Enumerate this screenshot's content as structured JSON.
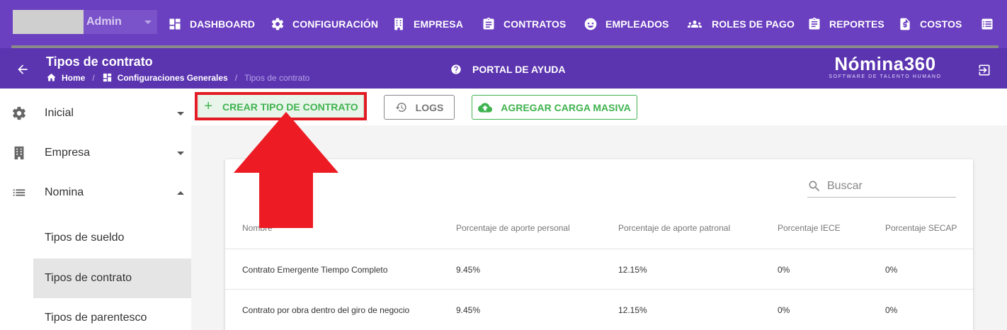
{
  "user": {
    "name": "Admin"
  },
  "nav": {
    "items": [
      {
        "label": "DASHBOARD",
        "icon": "dashboard-icon"
      },
      {
        "label": "CONFIGURACIÓN",
        "icon": "gear-icon"
      },
      {
        "label": "EMPRESA",
        "icon": "building-icon"
      },
      {
        "label": "CONTRATOS",
        "icon": "clipboard-icon"
      },
      {
        "label": "EMPLEADOS",
        "icon": "face-icon"
      },
      {
        "label": "ROLES DE PAGO",
        "icon": "people-icon"
      },
      {
        "label": "REPORTES",
        "icon": "report-icon"
      },
      {
        "label": "COSTOS",
        "icon": "cost-file-icon"
      }
    ]
  },
  "header": {
    "title": "Tipos de contrato",
    "breadcrumb": [
      "Home",
      "Configuraciones Generales",
      "Tipos de contrato"
    ],
    "help_label": "PORTAL DE AYUDA",
    "logo_word": "Nómina360",
    "logo_tagline": "SOFTWARE DE TALENTO HUMANO"
  },
  "sidebar": {
    "items": [
      {
        "label": "Inicial",
        "icon": "gear-icon",
        "expanded": false
      },
      {
        "label": "Empresa",
        "icon": "building-icon",
        "expanded": false
      },
      {
        "label": "Nomina",
        "icon": "list-icon",
        "expanded": true
      }
    ],
    "subitems": [
      {
        "label": "Tipos de sueldo",
        "active": false
      },
      {
        "label": "Tipos de contrato",
        "active": true
      },
      {
        "label": "Tipos de parentesco",
        "active": false
      }
    ]
  },
  "toolbar": {
    "create_label": "CREAR TIPO DE CONTRATO",
    "logs_label": "LOGS",
    "bulk_label": "AGREGAR CARGA MASIVA"
  },
  "table": {
    "search_placeholder": "Buscar",
    "columns": [
      "Nombre",
      "Porcentaje de aporte personal",
      "Porcentaje de aporte patronal",
      "Porcentaje IECE",
      "Porcentaje SECAP"
    ],
    "rows": [
      [
        "Contrato Emergente Tiempo Completo",
        "9.45%",
        "12.15%",
        "0%",
        "0%"
      ],
      [
        "Contrato por obra dentro del giro de negocio",
        "9.45%",
        "12.15%",
        "0%",
        "0%"
      ]
    ]
  },
  "colors": {
    "primary": "#6a3fc0",
    "header": "#5b34b0",
    "success": "#3fb34f",
    "annotation": "#e21b24"
  }
}
